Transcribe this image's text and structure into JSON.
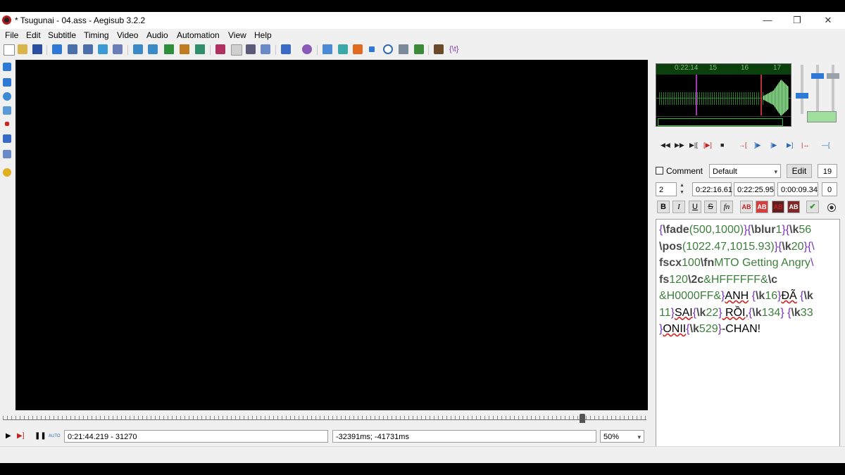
{
  "window": {
    "title": "* Tsugunai - 04.ass - Aegisub 3.2.2",
    "controls": [
      "—",
      "❐",
      "✕"
    ]
  },
  "menu": [
    "File",
    "Edit",
    "Subtitle",
    "Timing",
    "Video",
    "Audio",
    "Automation",
    "View",
    "Help"
  ],
  "video_bar": {
    "time": "0:21:44.219 - 31270",
    "offset": "-32391ms; -41731ms",
    "zoom": "50%",
    "auto_label": "AUTO"
  },
  "audio": {
    "ruler": [
      "0:22:14",
      "15",
      "16",
      "17"
    ]
  },
  "edit_panel": {
    "comment_label": "Comment",
    "style": "Default",
    "edit_button": "Edit",
    "actor_count": "19",
    "layer": "2",
    "start": "0:22:16.61",
    "end": "0:22:25.95",
    "duration": "0:00:09.34",
    "margin": "0"
  },
  "format_buttons": [
    "B",
    "I",
    "U",
    "S",
    "fn",
    "AB",
    "AB",
    "AB",
    "AB"
  ],
  "subtitle_text": {
    "l1": [
      "{",
      "\\fade",
      "(500,1000)",
      "}{",
      "\\blur",
      "1",
      "}{",
      "\\k",
      "56"
    ],
    "l2": [
      "\\pos",
      "(1022.47,1015.93)",
      "}{",
      "\\k",
      "20",
      "}{\\"
    ],
    "l3": [
      "fscx",
      "100",
      "\\fn",
      "MTO Getting Angry",
      "\\"
    ],
    "l4": [
      "fs",
      "120",
      "\\2c",
      "&HFFFFFF&",
      "\\c"
    ],
    "l5": [
      "&H0000FF&",
      "}",
      "ANH",
      " {",
      "\\k",
      "16",
      "}",
      "ĐÃ",
      " {",
      "\\k"
    ],
    "l6": [
      "11",
      "}",
      "SAI",
      "{",
      "\\k",
      "22",
      "}",
      " RỒI,",
      "{",
      "\\k",
      "134",
      "}",
      " {",
      "\\k",
      "33"
    ],
    "l7": [
      "}",
      "ONII",
      "{",
      "\\k",
      "529",
      "}",
      "-CHAN!"
    ]
  },
  "colors": {
    "waveform": "#2fa32f",
    "brace": "#7b2fbf",
    "value": "#3b7f3b",
    "marker_start": "#c03030",
    "marker_cursor": "#a03ab0"
  }
}
